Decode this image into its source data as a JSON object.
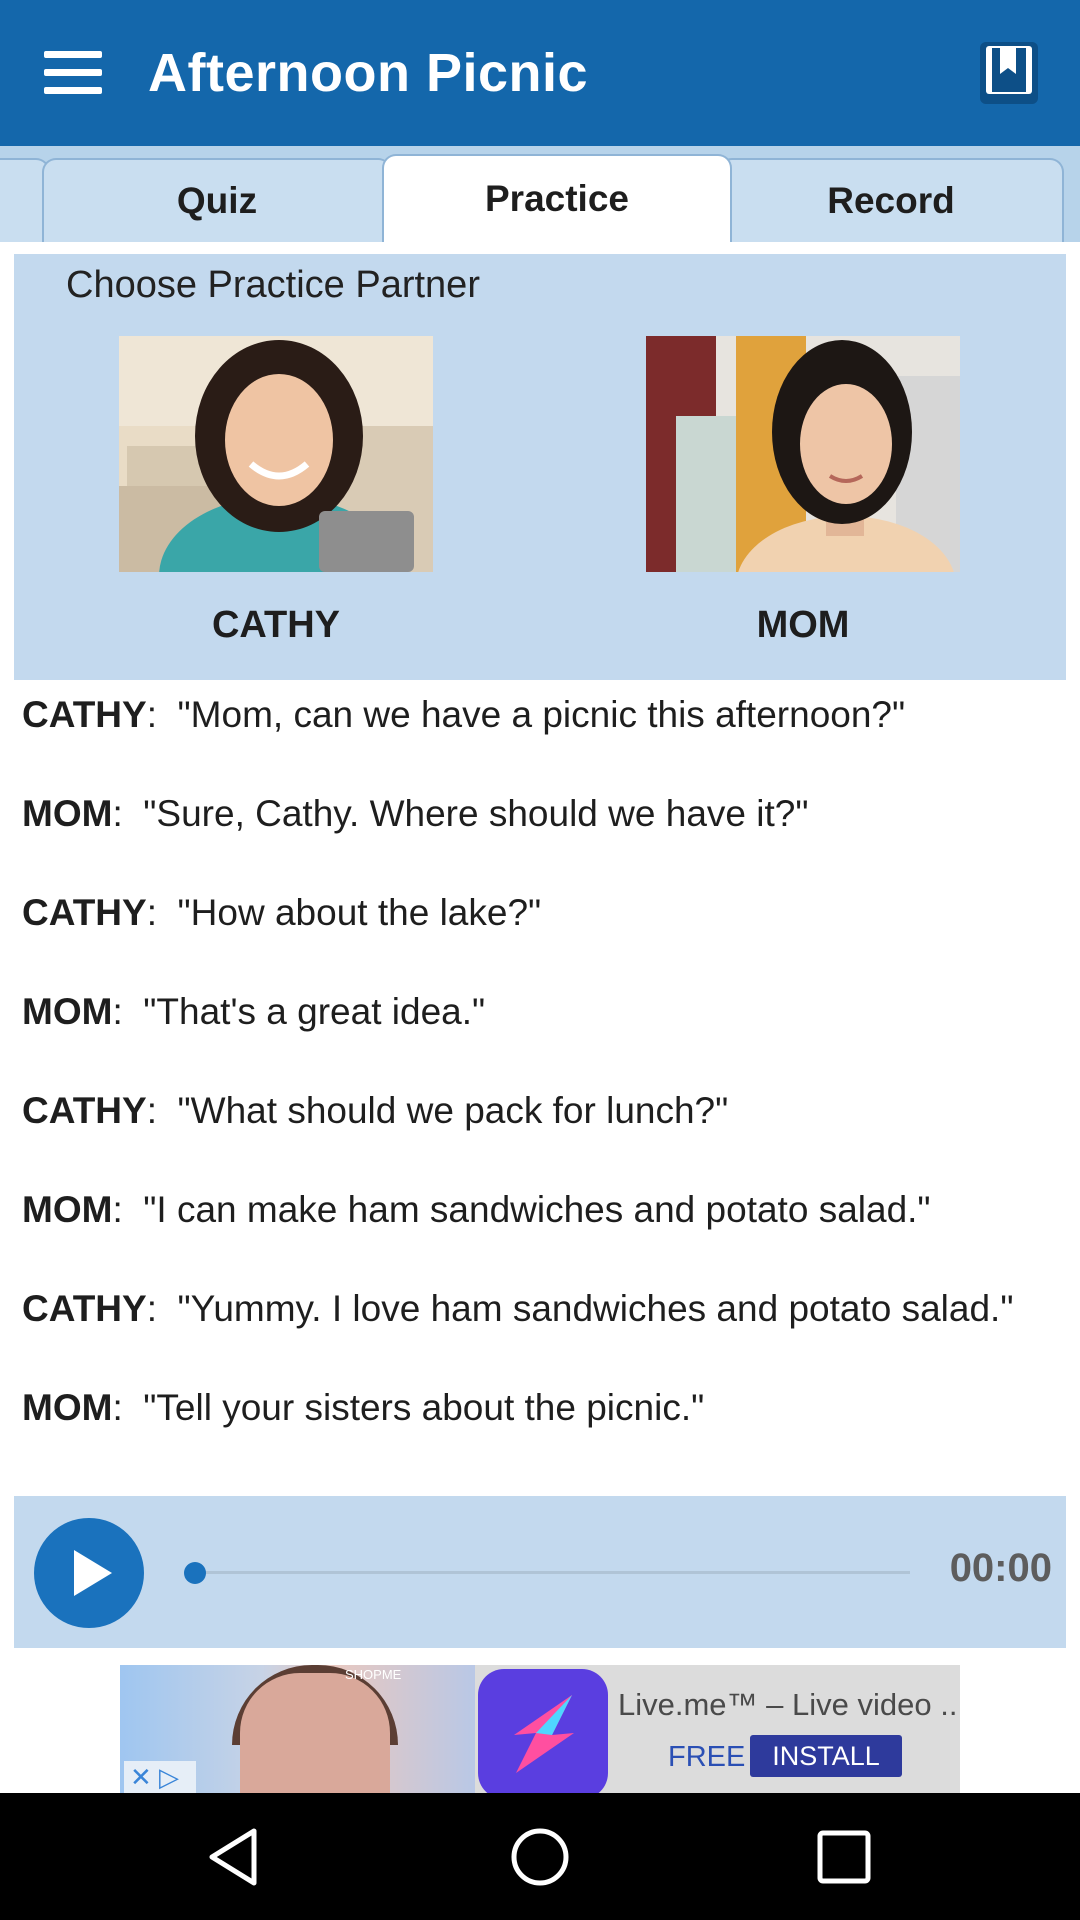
{
  "header": {
    "title": "Afternoon Picnic",
    "menu_icon": "hamburger-menu-icon",
    "book_icon": "bookmark-book-icon",
    "background": "#1467ab"
  },
  "tabs": [
    {
      "label": "Quiz",
      "selected": false
    },
    {
      "label": "Practice",
      "selected": true
    },
    {
      "label": "Record",
      "selected": false
    }
  ],
  "partner_panel": {
    "title": "Choose Practice Partner",
    "partners": [
      {
        "name": "CATHY"
      },
      {
        "name": "MOM"
      }
    ]
  },
  "dialogue": [
    {
      "speaker": "CATHY",
      "text": "\"Mom, can we have a picnic this afternoon?\""
    },
    {
      "speaker": "MOM",
      "text": "\"Sure, Cathy.  Where should we have it?\""
    },
    {
      "speaker": "CATHY",
      "text": "\"How about the lake?\""
    },
    {
      "speaker": "MOM",
      "text": "\"That's a great idea.\""
    },
    {
      "speaker": "CATHY",
      "text": "\"What should we pack for lunch?\""
    },
    {
      "speaker": "MOM",
      "text": "\"I can make ham sandwiches and potato salad.\""
    },
    {
      "speaker": "CATHY",
      "text": "\"Yummy. I love ham sandwiches and potato salad.\""
    },
    {
      "speaker": "MOM",
      "text": "\"Tell your sisters about the picnic.\""
    }
  ],
  "player": {
    "time": "00:00",
    "progress": 0,
    "play_icon": "play-icon",
    "accent": "#1a72bd"
  },
  "ad": {
    "source_tag": "SHOPME",
    "title": "Live.me™ – Live video ...",
    "price": "FREE",
    "install_label": "INSTALL"
  },
  "navbar": {
    "back_icon": "back-triangle-icon",
    "home_icon": "home-circle-icon",
    "recent_icon": "recent-apps-square-icon"
  }
}
